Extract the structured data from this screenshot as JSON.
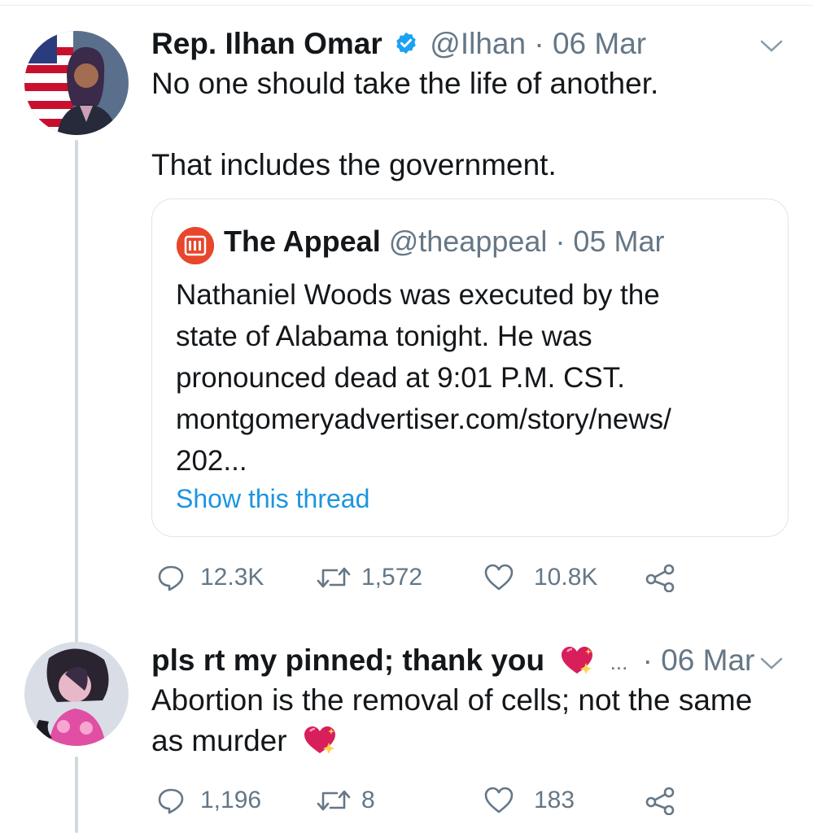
{
  "tweet1": {
    "name": "Rep. Ilhan Omar",
    "handle": "@Ilhan",
    "date": "· 06 Mar",
    "line1": "No one should take the life of another.",
    "line2": "That includes the government.",
    "quote": {
      "name": "The Appeal",
      "handle": "@theappeal",
      "date": "· 05 Mar",
      "lines": [
        "Nathaniel Woods was executed by the",
        "state of Alabama tonight. He was",
        "pronounced dead at 9:01 P.M. CST.",
        "montgomeryadvertiser.com/story/news/",
        "202..."
      ],
      "show_thread": "Show this thread"
    },
    "replies": "12.3K",
    "retweets": "1,572",
    "likes": "10.8K"
  },
  "tweet2": {
    "name": "pls rt my pinned; thank you",
    "ellipsis": "...",
    "date": "· 06 Mar",
    "line1": "Abortion is the removal of cells; not the same",
    "line2": "as murder",
    "replies": "1,196",
    "retweets": "8",
    "likes": "183"
  },
  "colors": {
    "verified": "#1da1f2",
    "link": "#1b95e0",
    "muted": "#657786",
    "appeal_brand": "#e8462d",
    "heart_emoji": "#d81e5b"
  }
}
